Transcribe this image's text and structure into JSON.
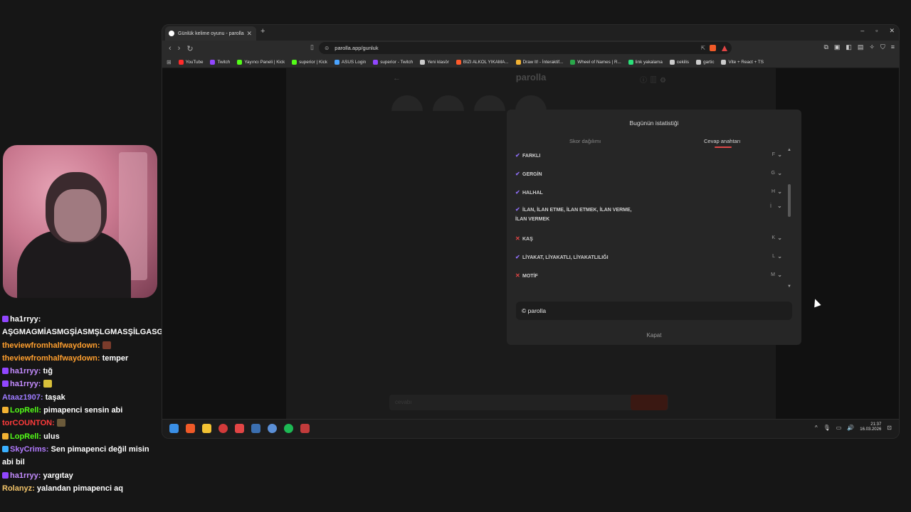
{
  "browser": {
    "tab_title": "Günlük kelime oyunu - parolla",
    "url": "parolla.app/gunluk",
    "bookmarks": [
      {
        "label": "YouTube",
        "color": "#ff2b2b"
      },
      {
        "label": "Twitch",
        "color": "#9146ff"
      },
      {
        "label": "Yayıncı Paneli | Kick",
        "color": "#53fc18"
      },
      {
        "label": "superior | Kick",
        "color": "#53fc18"
      },
      {
        "label": "ASUS Login",
        "color": "#4aa3ff"
      },
      {
        "label": "superior - Twitch",
        "color": "#9146ff"
      },
      {
        "label": "Yeni klasör",
        "color": "#cccccc"
      },
      {
        "label": "BIZI ALKOL YIKAMA...",
        "color": "#ff5a2b"
      },
      {
        "label": "Draw It! - İnteraktif...",
        "color": "#f2b233"
      },
      {
        "label": "Wheel of Names | R...",
        "color": "#2aa84a"
      },
      {
        "label": "link yakalama",
        "color": "#2be07a"
      },
      {
        "label": "cekilis",
        "color": "#cccccc"
      },
      {
        "label": "gartic",
        "color": "#cccccc"
      },
      {
        "label": "Vite + React + TS",
        "color": "#cccccc"
      }
    ]
  },
  "app": {
    "title": "parolla",
    "input_placeholder": "cevabı"
  },
  "modal": {
    "title": "Bugünün istatistiği",
    "tabs": {
      "distribution": "Skor dağılımı",
      "answer_key": "Cevap anahtarı"
    },
    "rows": [
      {
        "status": "ok",
        "answer": "FARKLI",
        "letter": "F"
      },
      {
        "status": "ok",
        "answer": "GERGİN",
        "letter": "G"
      },
      {
        "status": "ok",
        "answer": "HALHAL",
        "letter": "H"
      },
      {
        "status": "ok",
        "answer": "İLAN, İLAN ETME, İLAN ETMEK, İLAN VERME, İLAN VERMEK",
        "letter": "İ"
      },
      {
        "status": "no",
        "answer": "KAŞ",
        "letter": "K"
      },
      {
        "status": "ok",
        "answer": "LİYAKAT, LİYAKATLI, LİYAKATLILIĞI",
        "letter": "L"
      },
      {
        "status": "no",
        "answer": "MOTİF",
        "letter": "M"
      }
    ],
    "copy_text": "© parolla",
    "close_label": "Kapat"
  },
  "taskbar": {
    "time": "21:37",
    "date": "16.03.2026"
  },
  "chat": [
    {
      "user": "ha1rryy",
      "color": "#ffffff",
      "text": "AŞGMAGMİASMGŞİASMŞLGMASŞİLGASGAS",
      "badge": "#9146ff"
    },
    {
      "user": "theviewfromhalfwaydown",
      "color": "#ff9f2e",
      "text": "",
      "emote": "#7a3b2b"
    },
    {
      "user": "theviewfromhalfwaydown",
      "color": "#ff9f2e",
      "text": "temper"
    },
    {
      "user": "ha1rryy",
      "color": "#c48cff",
      "text": "tığ",
      "badge": "#9146ff"
    },
    {
      "user": "ha1rryy",
      "color": "#c48cff",
      "text": "",
      "badge": "#9146ff",
      "emote": "#d8c03a"
    },
    {
      "user": "Ataaz1907",
      "color": "#9d7bff",
      "text": "taşak"
    },
    {
      "user": "LopRell",
      "color": "#53fc18",
      "text": "pimapenci sensin abi",
      "badge": "#f2b233"
    },
    {
      "user": "torCOUNTON",
      "color": "#ff3b3b",
      "text": "",
      "emote": "#6b5a3a"
    },
    {
      "user": "LopRell",
      "color": "#53fc18",
      "text": "ulus",
      "badge": "#f2b233"
    },
    {
      "user": "SkyCrims",
      "color": "#b27bff",
      "text": "Sen pimapenci değil misin abi bil",
      "badge": "#3ab0ff"
    },
    {
      "user": "ha1rryy",
      "color": "#c48cff",
      "text": "yargıtay",
      "badge": "#9146ff"
    },
    {
      "user": "Rolanyz",
      "color": "#f2c46a",
      "text": "yalandan pimapenci aq"
    }
  ]
}
